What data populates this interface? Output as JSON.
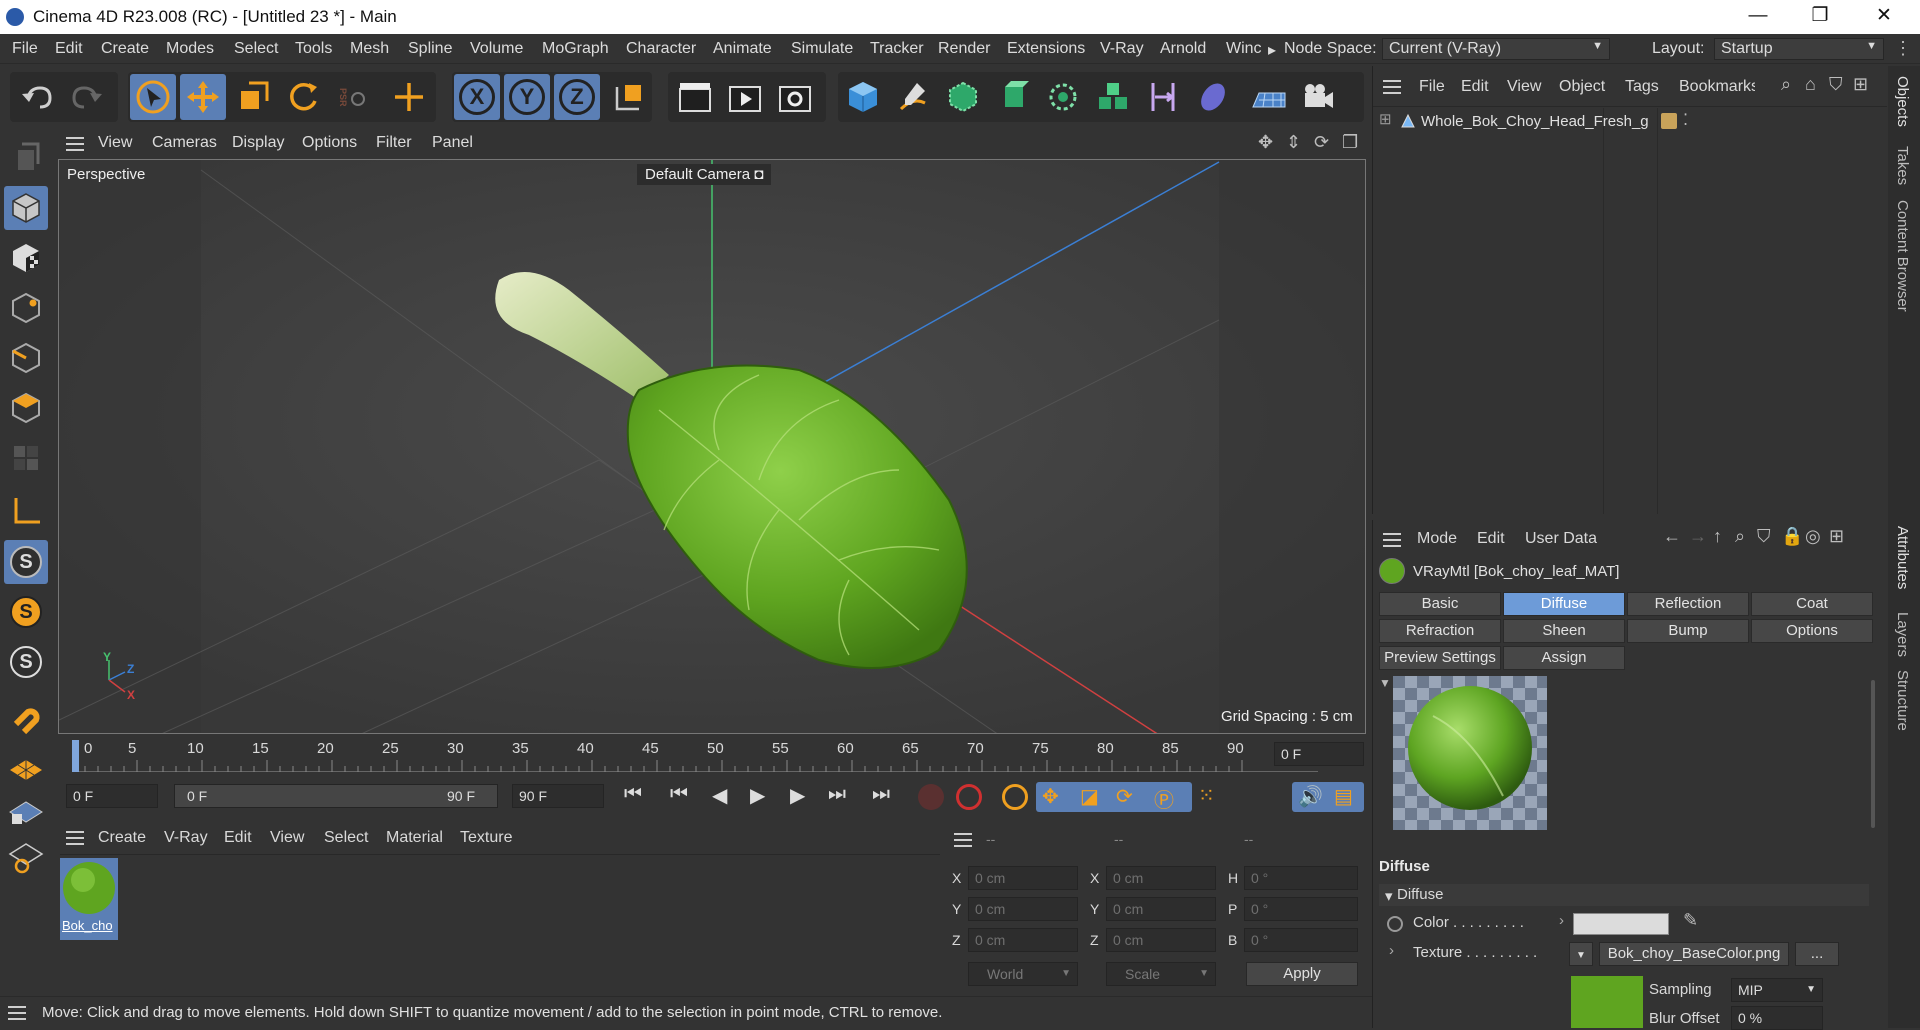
{
  "window": {
    "title": "Cinema 4D R23.008 (RC) - [Untitled 23 *] - Main",
    "minimize": "—",
    "restore": "❐",
    "close": "✕"
  },
  "menubar": {
    "items": [
      "File",
      "Edit",
      "Create",
      "Modes",
      "Select",
      "Tools",
      "Mesh",
      "Spline",
      "Volume",
      "MoGraph",
      "Character",
      "Animate",
      "Simulate",
      "Tracker",
      "Render",
      "Extensions",
      "V-Ray",
      "Arnold",
      "Winc"
    ],
    "overflow": "▸",
    "node_space_label": "Node Space:",
    "node_space_value": "Current (V-Ray)",
    "layout_label": "Layout:",
    "layout_value": "Startup"
  },
  "toolbar": {
    "xyz": [
      "X",
      "Y",
      "Z"
    ],
    "psr": "PSR"
  },
  "left_tools": {
    "s_labels": [
      "S",
      "S",
      "S"
    ]
  },
  "viewport": {
    "menu": [
      "View",
      "Cameras",
      "Display",
      "Options",
      "Filter",
      "Panel"
    ],
    "label": "Perspective",
    "camera": "Default Camera",
    "grid_spacing": "Grid Spacing : 5 cm",
    "axis_y": "Y",
    "axis_z": "Z",
    "axis_x": "X"
  },
  "timeline": {
    "ticks": [
      "0",
      "5",
      "10",
      "15",
      "20",
      "25",
      "30",
      "35",
      "40",
      "45",
      "50",
      "55",
      "60",
      "65",
      "70",
      "75",
      "80",
      "85",
      "90"
    ],
    "current_frame": "0 F"
  },
  "transport": {
    "start": "0 F",
    "range_start": "0 F",
    "range_end": "90 F",
    "end": "90 F"
  },
  "material_manager": {
    "menu": [
      "Create",
      "V-Ray",
      "Edit",
      "View",
      "Select",
      "Material",
      "Texture"
    ],
    "material_name": "Bok_cho"
  },
  "coordinates": {
    "headers": [
      "--",
      "--",
      "--"
    ],
    "rows": [
      {
        "a": "X",
        "av": "0 cm",
        "b": "X",
        "bv": "0 cm",
        "c": "H",
        "cv": "0 °"
      },
      {
        "a": "Y",
        "av": "0 cm",
        "b": "Y",
        "bv": "0 cm",
        "c": "P",
        "cv": "0 °"
      },
      {
        "a": "Z",
        "av": "0 cm",
        "b": "Z",
        "bv": "0 cm",
        "c": "B",
        "cv": "0 °"
      }
    ],
    "mode": "World",
    "scale": "Scale",
    "apply": "Apply"
  },
  "object_manager": {
    "menu": [
      "File",
      "Edit",
      "View",
      "Object",
      "Tags",
      "Bookmarks"
    ],
    "object_name": "Whole_Bok_Choy_Head_Fresh_g"
  },
  "attributes": {
    "menu": [
      "Mode",
      "Edit",
      "User Data"
    ],
    "material_title": "VRayMtl [Bok_choy_leaf_MAT]",
    "tabs_row1": [
      "Basic",
      "Diffuse",
      "Reflection",
      "Coat"
    ],
    "tabs_row2": [
      "Refraction",
      "Sheen",
      "Bump",
      "Options"
    ],
    "tabs_row3": [
      "Preview Settings",
      "Assign"
    ],
    "selected_tab": "Diffuse",
    "section": "Diffuse",
    "group": "Diffuse",
    "color_label": "Color . . . . . . . . .",
    "texture_label": "Texture . . . . . . . . .",
    "texture_file": "Bok_choy_BaseColor.png",
    "texture_more": "...",
    "sampling_label": "Sampling",
    "sampling_value": "MIP",
    "blur_label": "Blur Offset",
    "blur_value": "0 %",
    "swatch_color": "#dcdcdc"
  },
  "right_tabs": [
    "Objects",
    "Takes",
    "Content Browser",
    "Attributes",
    "Layers",
    "Structure"
  ],
  "status": "Move: Click and drag to move elements. Hold down SHIFT to quantize movement / add to the selection in point mode, CTRL to remove.",
  "colors": {
    "accent": "#5b7fb5",
    "tab_selected": "#6d9bd8",
    "orange": "#f0a020",
    "axis_y": "#46c26e",
    "axis_x": "#d04040",
    "axis_z": "#3b7fd4"
  }
}
